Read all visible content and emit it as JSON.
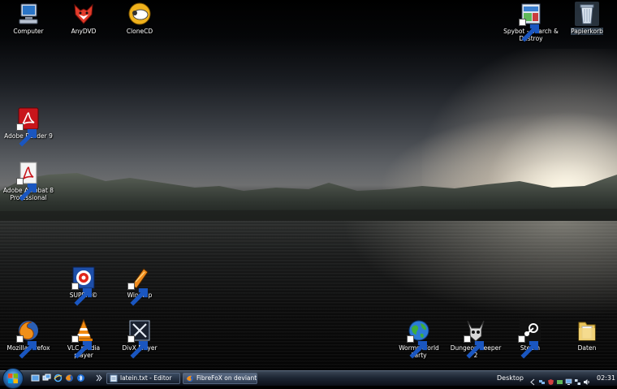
{
  "desktop_icons": {
    "computer": "Computer",
    "anydvd": "AnyDVD",
    "clonecd": "CloneCD",
    "spybot": "Spybot - Search & Destroy",
    "recycle_bin": "Papierkorb",
    "adobe_reader": "Adobe Reader 9",
    "adobe_acrobat": "Adobe Acrobat 8 Professional",
    "super": "SUPER ©",
    "winamp": "Winamp",
    "firefox": "Mozilla Firefox",
    "vlc": "VLC media player",
    "divx": "DivX Player",
    "worms": "Worms World Party",
    "dungeon_keeper": "Dungeon Keeper 2",
    "steam": "Steam",
    "daten": "Daten"
  },
  "taskbar": {
    "tasks": [
      {
        "label": "latein.txt - Editor",
        "icon": "notepad-icon"
      },
      {
        "label": "FibreFoX on deviant...",
        "icon": "firefox-icon"
      }
    ],
    "toolbar_label": "Desktop",
    "clock": "02:31"
  }
}
